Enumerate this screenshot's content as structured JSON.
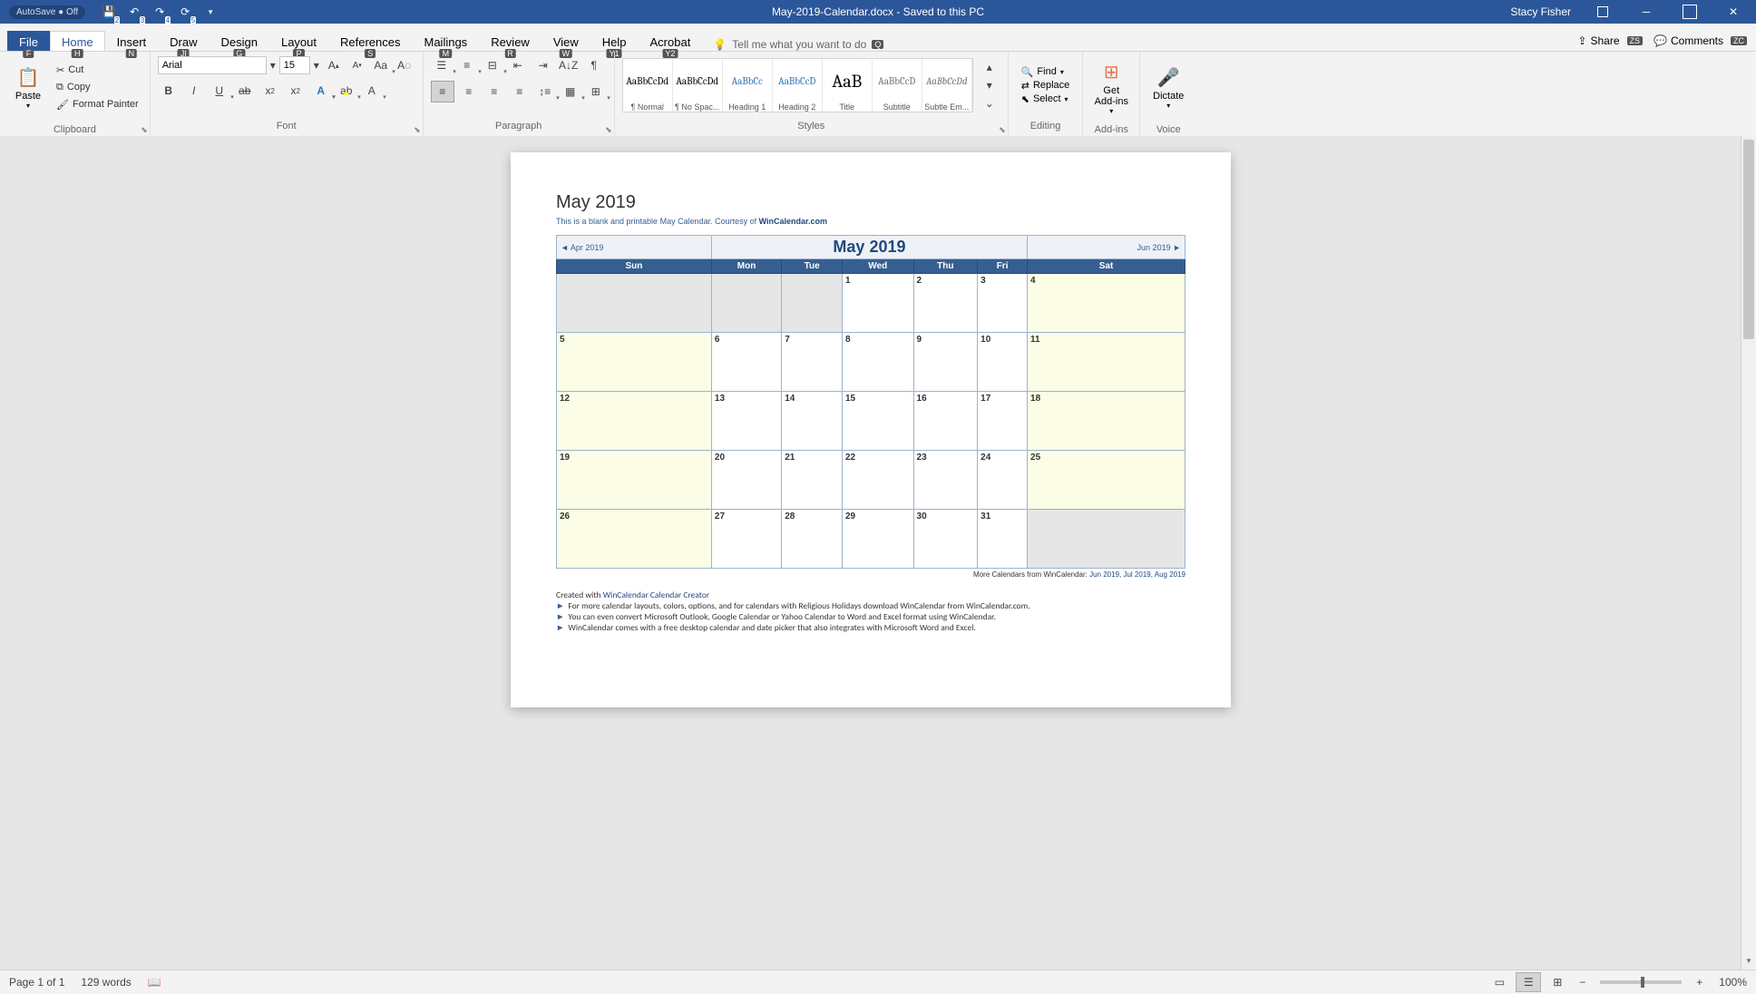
{
  "titlebar": {
    "autosave": "AutoSave",
    "autosave_state": "Off",
    "qat_items": [
      "save",
      "undo",
      "redo",
      "refresh"
    ],
    "doc_title": "May-2019-Calendar.docx  -  Saved to this PC",
    "user": "Stacy Fisher"
  },
  "tabs": {
    "file": {
      "label": "File",
      "key": "F"
    },
    "home": {
      "label": "Home",
      "key": "H"
    },
    "insert": {
      "label": "Insert",
      "key": "N"
    },
    "draw": {
      "label": "Draw",
      "key": "JI"
    },
    "design": {
      "label": "Design",
      "key": "G"
    },
    "layout": {
      "label": "Layout",
      "key": "P"
    },
    "references": {
      "label": "References",
      "key": "S"
    },
    "mailings": {
      "label": "Mailings",
      "key": "M"
    },
    "review": {
      "label": "Review",
      "key": "R"
    },
    "view": {
      "label": "View",
      "key": "W"
    },
    "help": {
      "label": "Help",
      "key": "Y1"
    },
    "acrobat": {
      "label": "Acrobat",
      "key": "Y2"
    },
    "tellme": "Tell me what you want to do",
    "tellme_key": "Q",
    "share": {
      "label": "Share",
      "key": "ZS"
    },
    "comments": {
      "label": "Comments",
      "key": "ZC"
    }
  },
  "ribbon": {
    "clipboard": {
      "paste": "Paste",
      "cut": "Cut",
      "copy": "Copy",
      "format_painter": "Format Painter",
      "label": "Clipboard"
    },
    "font": {
      "name": "Arial",
      "size": "15",
      "label": "Font"
    },
    "paragraph": {
      "label": "Paragraph"
    },
    "styles": {
      "label": "Styles",
      "items": [
        {
          "preview": "AaBbCcDd",
          "name": "¶ Normal"
        },
        {
          "preview": "AaBbCcDd",
          "name": "¶ No Spac..."
        },
        {
          "preview": "AaBbCc",
          "name": "Heading 1",
          "color": "#2e74b5"
        },
        {
          "preview": "AaBbCcD",
          "name": "Heading 2",
          "color": "#2e74b5"
        },
        {
          "preview": "AaB",
          "name": "Title",
          "size": "20px"
        },
        {
          "preview": "AaBbCcD",
          "name": "Subtitle",
          "color": "#767171"
        },
        {
          "preview": "AaBbCcDd",
          "name": "Subtle Em...",
          "color": "#767171",
          "italic": true
        }
      ]
    },
    "editing": {
      "find": "Find",
      "replace": "Replace",
      "select": "Select",
      "label": "Editing"
    },
    "addins": {
      "get": "Get",
      "addins": "Add-ins",
      "label": "Add-ins"
    },
    "voice": {
      "dictate": "Dictate",
      "label": "Voice"
    }
  },
  "document": {
    "title": "May 2019",
    "subtitle_pre": "This is a blank and printable May Calendar.  Courtesy of ",
    "subtitle_link": "WinCalendar.com",
    "cal": {
      "prev": "◄ Apr 2019",
      "title": "May   2019",
      "next": "Jun 2019 ►",
      "days": [
        "Sun",
        "Mon",
        "Tue",
        "Wed",
        "Thu",
        "Fri",
        "Sat"
      ],
      "rows": [
        [
          {
            "n": "",
            "c": "grey"
          },
          {
            "n": "",
            "c": "grey"
          },
          {
            "n": "",
            "c": "grey"
          },
          {
            "n": "1",
            "c": ""
          },
          {
            "n": "2",
            "c": ""
          },
          {
            "n": "3",
            "c": ""
          },
          {
            "n": "4",
            "c": "yellow"
          }
        ],
        [
          {
            "n": "5",
            "c": "yellow"
          },
          {
            "n": "6",
            "c": ""
          },
          {
            "n": "7",
            "c": ""
          },
          {
            "n": "8",
            "c": ""
          },
          {
            "n": "9",
            "c": ""
          },
          {
            "n": "10",
            "c": ""
          },
          {
            "n": "11",
            "c": "yellow"
          }
        ],
        [
          {
            "n": "12",
            "c": "yellow"
          },
          {
            "n": "13",
            "c": ""
          },
          {
            "n": "14",
            "c": ""
          },
          {
            "n": "15",
            "c": ""
          },
          {
            "n": "16",
            "c": ""
          },
          {
            "n": "17",
            "c": ""
          },
          {
            "n": "18",
            "c": "yellow"
          }
        ],
        [
          {
            "n": "19",
            "c": "yellow"
          },
          {
            "n": "20",
            "c": ""
          },
          {
            "n": "21",
            "c": ""
          },
          {
            "n": "22",
            "c": ""
          },
          {
            "n": "23",
            "c": ""
          },
          {
            "n": "24",
            "c": ""
          },
          {
            "n": "25",
            "c": "yellow"
          }
        ],
        [
          {
            "n": "26",
            "c": "yellow"
          },
          {
            "n": "27",
            "c": ""
          },
          {
            "n": "28",
            "c": ""
          },
          {
            "n": "29",
            "c": ""
          },
          {
            "n": "30",
            "c": ""
          },
          {
            "n": "31",
            "c": ""
          },
          {
            "n": "",
            "c": "grey"
          }
        ]
      ]
    },
    "more_pre": "More Calendars from WinCalendar: ",
    "more_links": [
      "Jun 2019",
      "Jul 2019",
      "Aug 2019"
    ],
    "created_pre": "Created with ",
    "created_link": "WinCalendar Calendar Creator",
    "bullets": [
      "For more calendar layouts, colors, options, and for calendars with Religious Holidays download WinCalendar from WinCalendar.com.",
      "You can even convert Microsoft Outlook, Google Calendar or Yahoo Calendar to Word and Excel format using WinCalendar.",
      "WinCalendar comes with a free desktop calendar and date picker that also integrates with Microsoft Word and Excel."
    ]
  },
  "status": {
    "page": "Page 1 of 1",
    "words": "129 words",
    "zoom": "100%"
  }
}
